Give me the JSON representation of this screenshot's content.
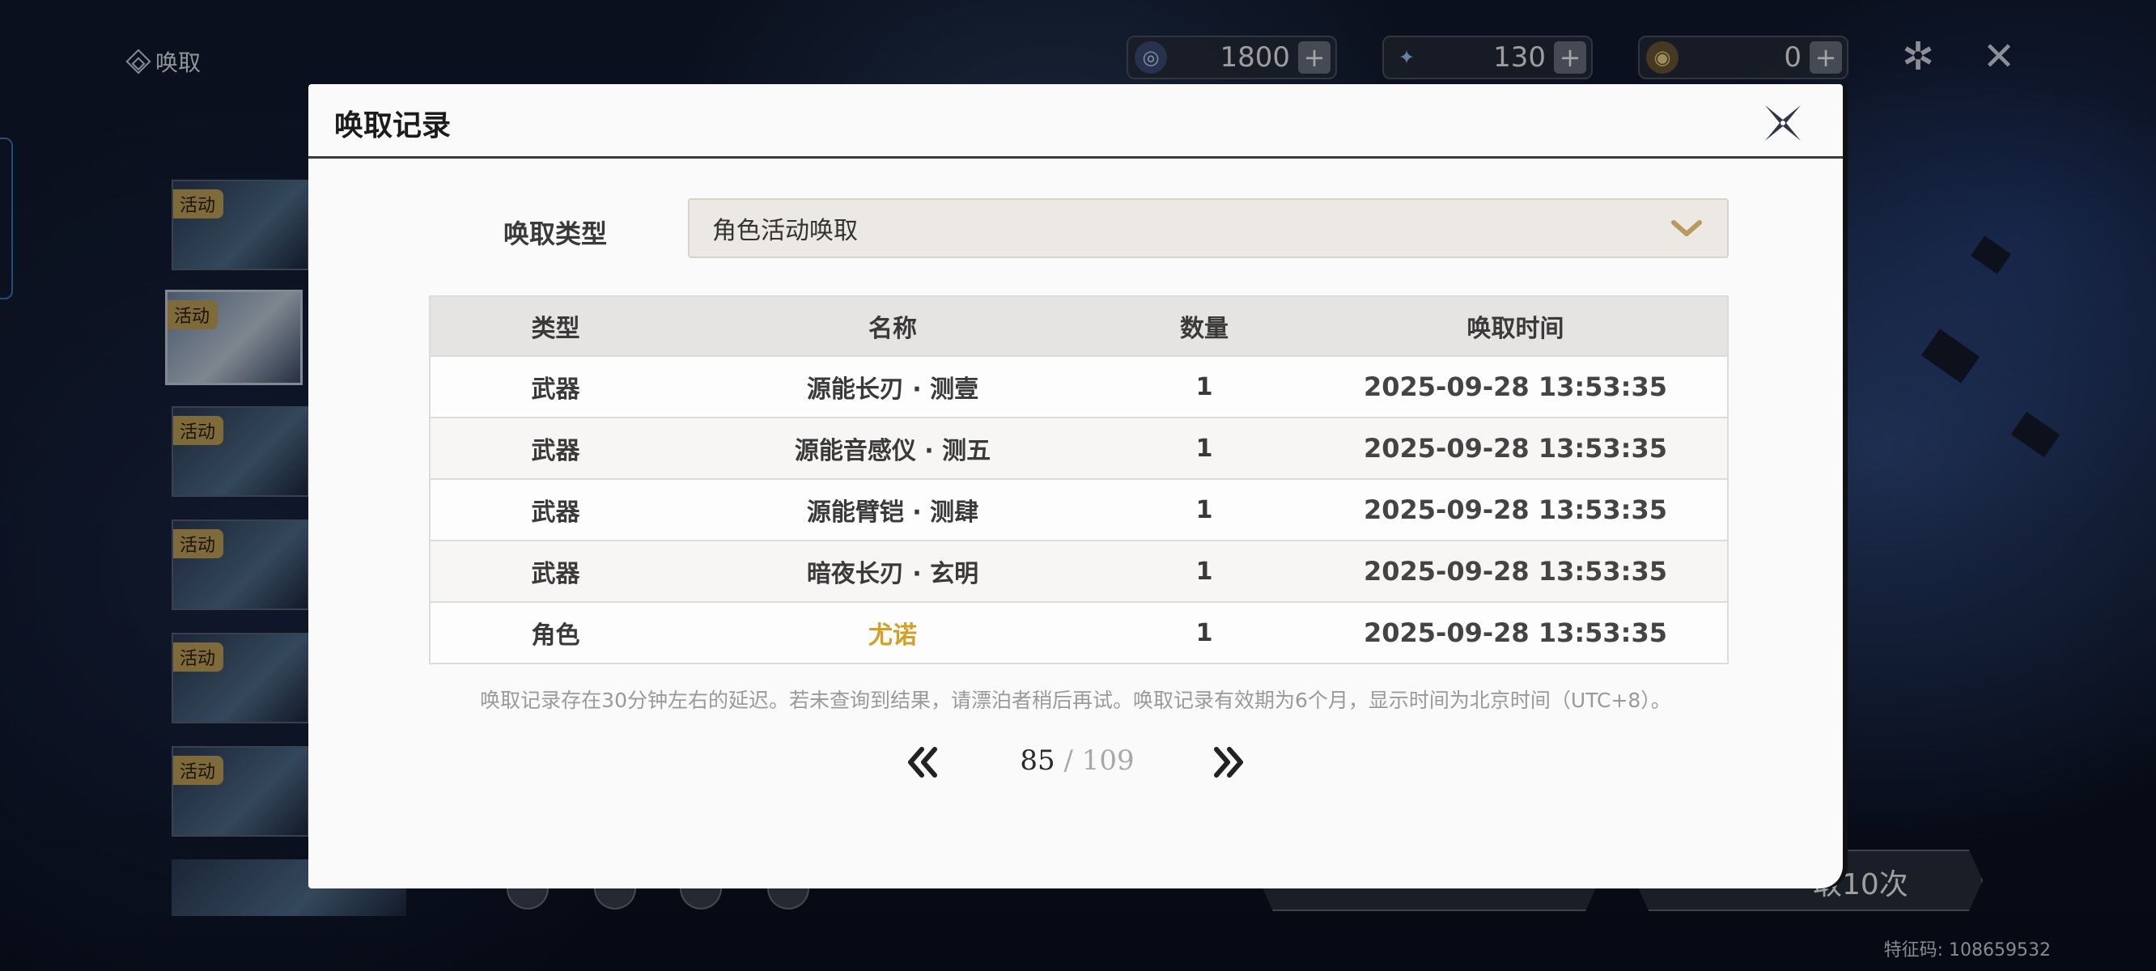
{
  "app": {
    "title": "唤取"
  },
  "currency": [
    {
      "icon": "astrite-icon",
      "value": "1800"
    },
    {
      "icon": "radiant-tide-icon",
      "value": "130"
    },
    {
      "icon": "lunite-icon",
      "value": "0"
    }
  ],
  "banners": {
    "tag": "活动"
  },
  "bottom": {
    "pull10_label": "取10次",
    "feature_code": "特征码: 108659532"
  },
  "modal": {
    "title": "唤取记录",
    "filter_label": "唤取类型",
    "filter_value": "角色活动唤取",
    "columns": [
      "类型",
      "名称",
      "数量",
      "唤取时间"
    ],
    "rows": [
      {
        "type": "武器",
        "name": "源能长刃 · 测壹",
        "qty": "1",
        "time": "2025-09-28 13:53:35"
      },
      {
        "type": "武器",
        "name": "源能音感仪 · 测五",
        "qty": "1",
        "time": "2025-09-28 13:53:35"
      },
      {
        "type": "武器",
        "name": "源能臂铠 · 测肆",
        "qty": "1",
        "time": "2025-09-28 13:53:35"
      },
      {
        "type": "武器",
        "name": "暗夜长刃 · 玄明",
        "qty": "1",
        "time": "2025-09-28 13:53:35"
      },
      {
        "type": "角色",
        "name": "尤诺",
        "qty": "1",
        "time": "2025-09-28 13:53:35"
      }
    ],
    "notice": "唤取记录存在30分钟左右的延迟。若未查询到结果，请漂泊者稍后再试。唤取记录有效期为6个月，显示时间为北京时间（UTC+8）。",
    "pager": {
      "current": "85",
      "separator": "/",
      "total": "109"
    }
  },
  "colors": {
    "gold_accent": "#d0a125",
    "banner_tag": "#c4a35a",
    "dropdown_chevron": "#b89a5a"
  }
}
